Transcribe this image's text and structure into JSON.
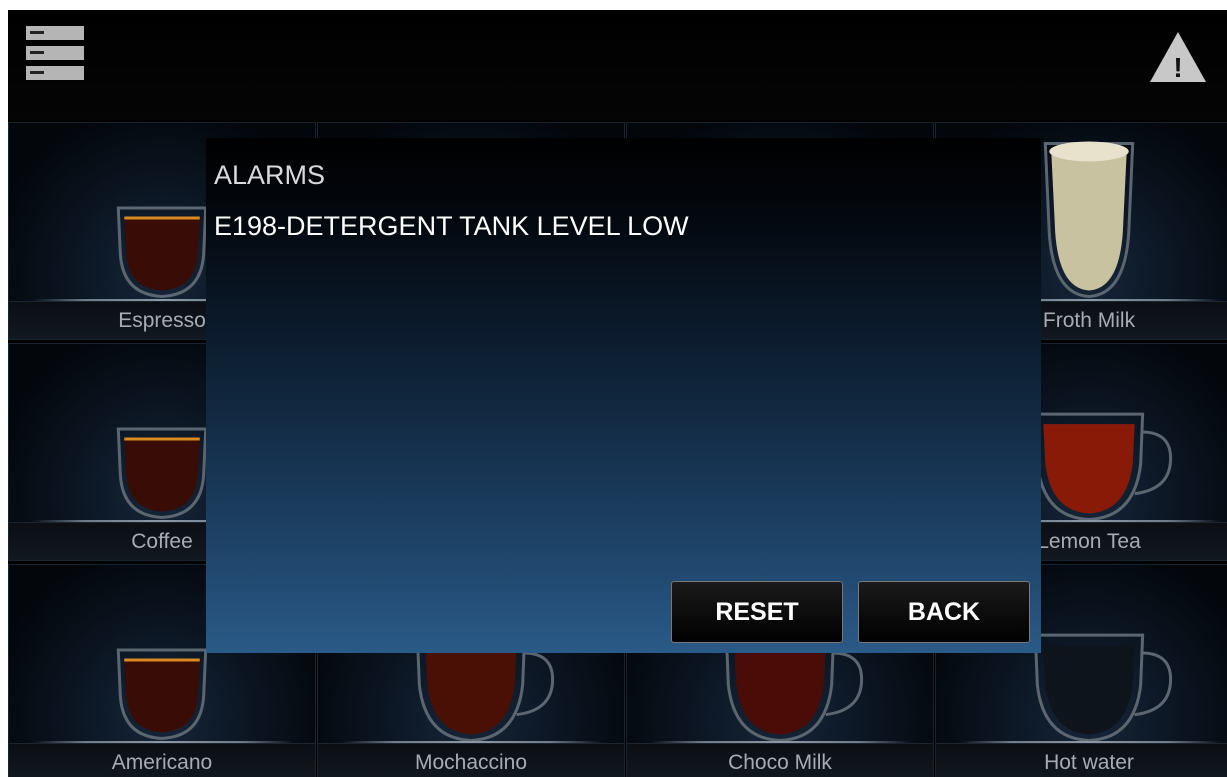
{
  "header": {
    "menu_icon": "menu-icon",
    "alarm_icon": "warning-triangle-icon",
    "alarm_icon_glyph": "!"
  },
  "products": [
    {
      "label": "Espresso",
      "cup": "glass",
      "fill": "#3a0c06"
    },
    {
      "label": "",
      "cup": "glass",
      "fill": "#3a0c06"
    },
    {
      "label": "",
      "cup": "glass",
      "fill": "#3a0c06"
    },
    {
      "label": "Froth Milk",
      "cup": "tall-glass",
      "fill": "#c9c2a0"
    },
    {
      "label": "Coffee",
      "cup": "glass",
      "fill": "#3a0c06"
    },
    {
      "label": "",
      "cup": "mug",
      "fill": "#3a0c06"
    },
    {
      "label": "",
      "cup": "mug",
      "fill": "#3a0c06"
    },
    {
      "label": "Lemon Tea",
      "cup": "mug",
      "fill": "#8a1a08"
    },
    {
      "label": "Americano",
      "cup": "glass",
      "fill": "#3a0c06"
    },
    {
      "label": "Mochaccino",
      "cup": "mug",
      "fill": "#4a1006"
    },
    {
      "label": "Choco Milk",
      "cup": "mug",
      "fill": "#4a0c06"
    },
    {
      "label": "Hot water",
      "cup": "mug",
      "fill": "#0e141c"
    }
  ],
  "dialog": {
    "title": "ALARMS",
    "alarm_text": "E198-DETERGENT TANK LEVEL LOW",
    "reset_label": "RESET",
    "back_label": "BACK"
  },
  "colors": {
    "background": "#000000",
    "dialog_gradient_bottom": "#2a5a87",
    "label_text": "#a7acb2"
  }
}
